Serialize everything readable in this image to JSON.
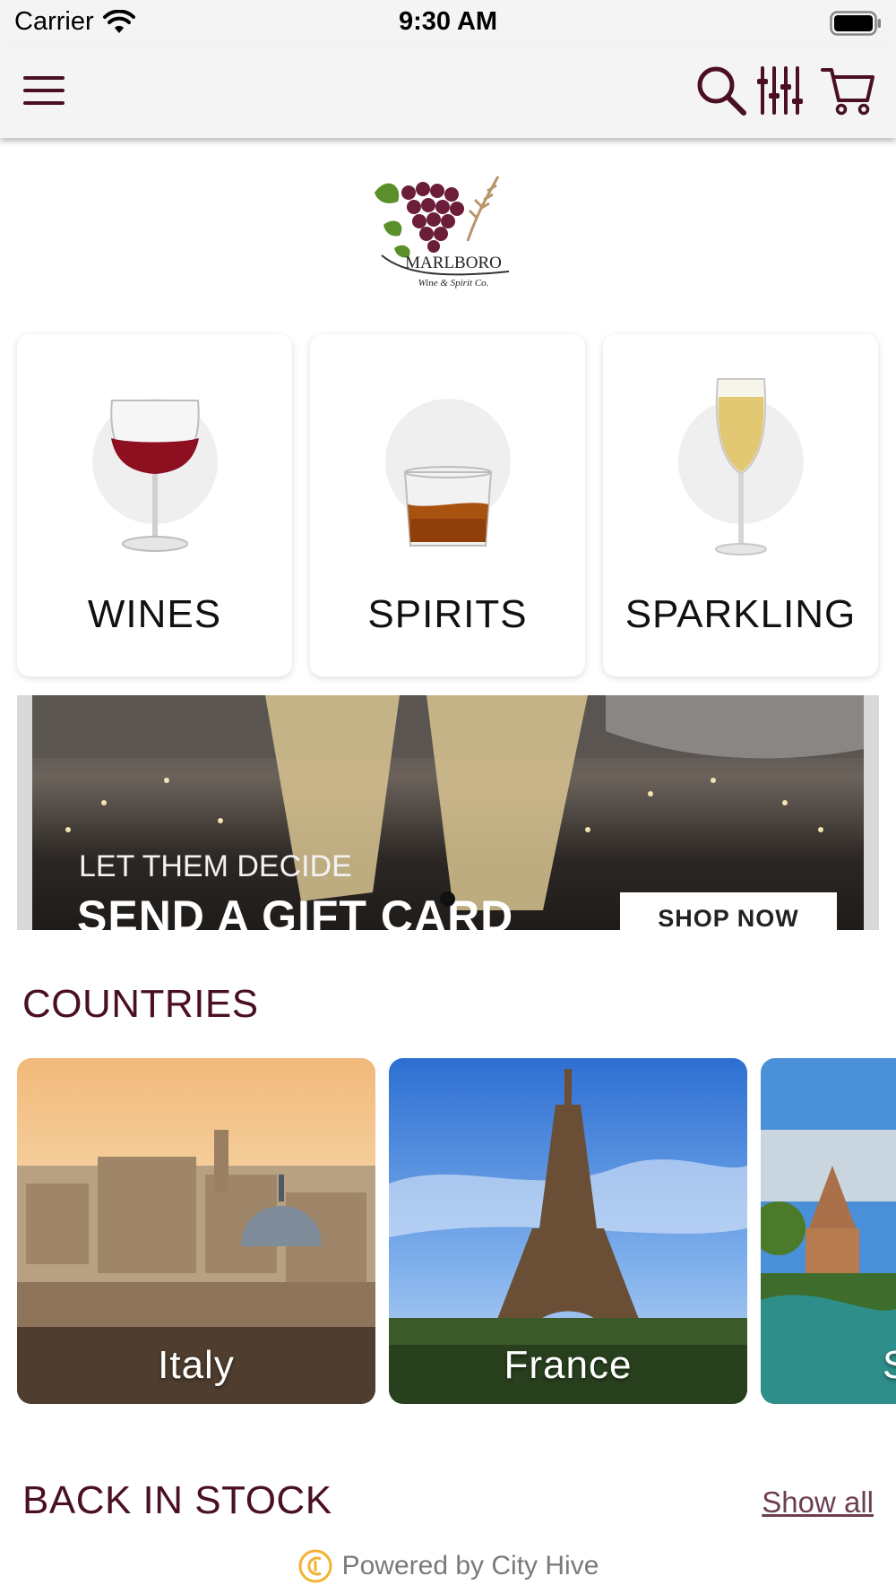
{
  "status_bar": {
    "carrier": "Carrier",
    "time": "9:30 AM"
  },
  "nav": {
    "icons": [
      "menu-icon",
      "search-icon",
      "filter-icon",
      "cart-icon"
    ]
  },
  "logo": {
    "name": "MARLBORO",
    "tagline": "Wine & Spirit Co."
  },
  "categories": [
    {
      "label": "WINES",
      "icon": "wine-glass-icon"
    },
    {
      "label": "SPIRITS",
      "icon": "whiskey-glass-icon"
    },
    {
      "label": "SPARKLING",
      "icon": "champagne-flute-icon"
    }
  ],
  "banner": {
    "subtitle": "LET THEM DECIDE",
    "title": "SEND A GIFT CARD",
    "button": "SHOP NOW",
    "page_dots": 1
  },
  "countries_section": {
    "title": "COUNTRIES",
    "items": [
      {
        "label": "Italy"
      },
      {
        "label": "France"
      },
      {
        "label": "S"
      }
    ]
  },
  "back_in_stock": {
    "title": "BACK IN STOCK",
    "link": "Show all"
  },
  "footer": {
    "powered_by": "Powered by City Hive"
  },
  "colors": {
    "brand": "#4a0f24",
    "link": "#6c3f52",
    "bar_bg": "#f4f4f4"
  }
}
